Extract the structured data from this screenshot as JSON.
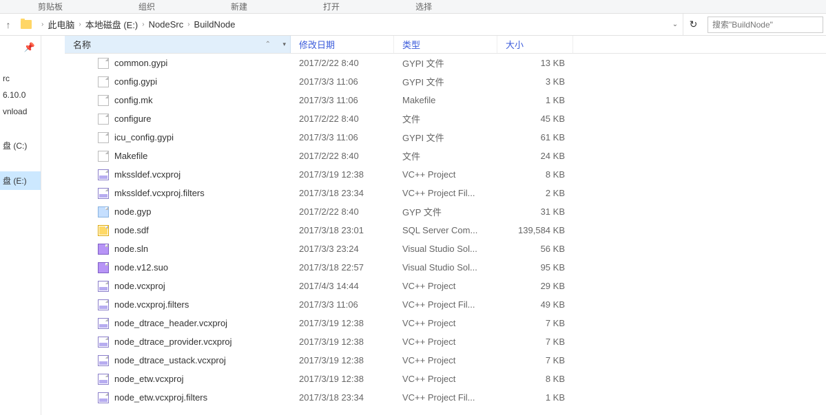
{
  "ribbon": {
    "tabs": [
      "剪贴板",
      "组织",
      "新建",
      "打开",
      "选择"
    ]
  },
  "breadcrumb": {
    "root": "此电脑",
    "parts": [
      "本地磁盘 (E:)",
      "NodeSrc",
      "BuildNode"
    ]
  },
  "search": {
    "placeholder": "搜索\"BuildNode\""
  },
  "sidebar": {
    "items": [
      {
        "label": ""
      },
      {
        "label": "rc"
      },
      {
        "label": "6.10.0"
      },
      {
        "label": "vnload"
      },
      {
        "label": ""
      },
      {
        "label": "盘 (C:)"
      },
      {
        "label": ""
      },
      {
        "label": "盘 (E:)",
        "selected": true
      }
    ]
  },
  "columns": {
    "name": "名称",
    "date": "修改日期",
    "type": "类型",
    "size": "大小"
  },
  "files": [
    {
      "icon": "file",
      "name": "common.gypi",
      "date": "2017/2/22 8:40",
      "type": "GYPI 文件",
      "size": "13 KB"
    },
    {
      "icon": "file",
      "name": "config.gypi",
      "date": "2017/3/3 11:06",
      "type": "GYPI 文件",
      "size": "3 KB"
    },
    {
      "icon": "file",
      "name": "config.mk",
      "date": "2017/3/3 11:06",
      "type": "Makefile",
      "size": "1 KB"
    },
    {
      "icon": "file",
      "name": "configure",
      "date": "2017/2/22 8:40",
      "type": "文件",
      "size": "45 KB"
    },
    {
      "icon": "file",
      "name": "icu_config.gypi",
      "date": "2017/3/3 11:06",
      "type": "GYPI 文件",
      "size": "61 KB"
    },
    {
      "icon": "file",
      "name": "Makefile",
      "date": "2017/2/22 8:40",
      "type": "文件",
      "size": "24 KB"
    },
    {
      "icon": "vcx",
      "name": "mkssldef.vcxproj",
      "date": "2017/3/19 12:38",
      "type": "VC++ Project",
      "size": "8 KB"
    },
    {
      "icon": "vcx",
      "name": "mkssldef.vcxproj.filters",
      "date": "2017/3/18 23:34",
      "type": "VC++ Project Fil...",
      "size": "2 KB"
    },
    {
      "icon": "gyp",
      "name": "node.gyp",
      "date": "2017/2/22 8:40",
      "type": "GYP 文件",
      "size": "31 KB"
    },
    {
      "icon": "sdf",
      "name": "node.sdf",
      "date": "2017/3/18 23:01",
      "type": "SQL Server Com...",
      "size": "139,584 KB"
    },
    {
      "icon": "sln",
      "name": "node.sln",
      "date": "2017/3/3 23:24",
      "type": "Visual Studio Sol...",
      "size": "56 KB"
    },
    {
      "icon": "sln",
      "name": "node.v12.suo",
      "date": "2017/3/18 22:57",
      "type": "Visual Studio Sol...",
      "size": "95 KB"
    },
    {
      "icon": "vcx",
      "name": "node.vcxproj",
      "date": "2017/4/3 14:44",
      "type": "VC++ Project",
      "size": "29 KB"
    },
    {
      "icon": "vcx",
      "name": "node.vcxproj.filters",
      "date": "2017/3/3 11:06",
      "type": "VC++ Project Fil...",
      "size": "49 KB"
    },
    {
      "icon": "vcx",
      "name": "node_dtrace_header.vcxproj",
      "date": "2017/3/19 12:38",
      "type": "VC++ Project",
      "size": "7 KB"
    },
    {
      "icon": "vcx",
      "name": "node_dtrace_provider.vcxproj",
      "date": "2017/3/19 12:38",
      "type": "VC++ Project",
      "size": "7 KB"
    },
    {
      "icon": "vcx",
      "name": "node_dtrace_ustack.vcxproj",
      "date": "2017/3/19 12:38",
      "type": "VC++ Project",
      "size": "7 KB"
    },
    {
      "icon": "vcx",
      "name": "node_etw.vcxproj",
      "date": "2017/3/19 12:38",
      "type": "VC++ Project",
      "size": "8 KB"
    },
    {
      "icon": "vcx",
      "name": "node_etw.vcxproj.filters",
      "date": "2017/3/18 23:34",
      "type": "VC++ Project Fil...",
      "size": "1 KB"
    }
  ]
}
